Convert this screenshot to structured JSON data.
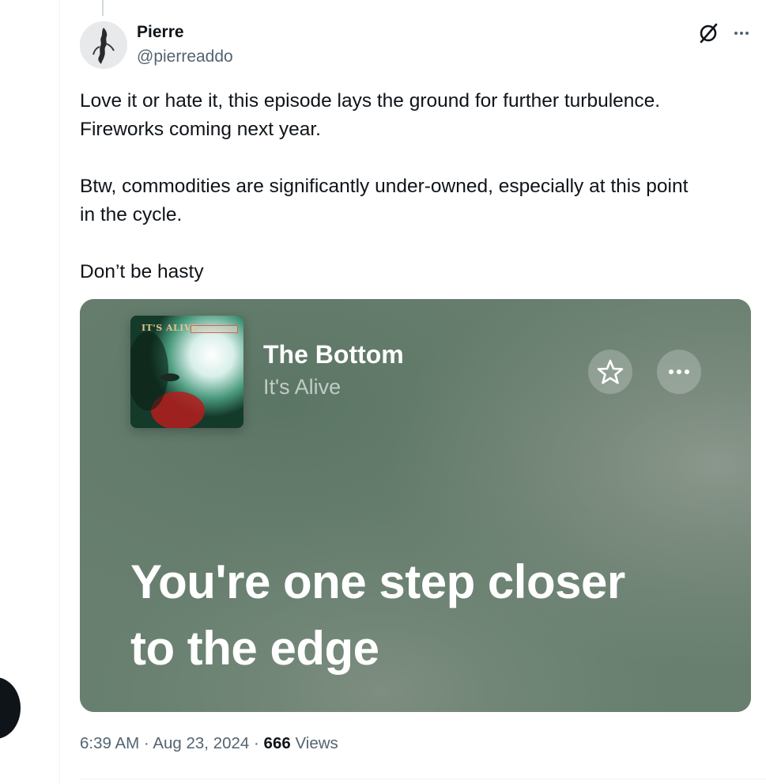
{
  "tweet": {
    "author": {
      "display_name": "Pierre",
      "handle": "@pierreaddo"
    },
    "icons": {
      "grok": "grok-icon",
      "more": "more-horizontal-icon"
    },
    "text_lines": [
      "Love it or hate it, this episode lays the ground for further turbulence.",
      "Fireworks coming next year.",
      "Btw, commodities are significantly under-owned, especially at this point",
      "in the cycle.",
      "Don’t be hasty"
    ],
    "media": {
      "album_label": "IT'S ALIVE",
      "song_title": "The Bottom",
      "artist": "It's Alive",
      "lyric_lines": [
        "You're one step closer",
        "to the edge"
      ],
      "background_color": "#6d8474"
    },
    "meta": {
      "time": "6:39 AM",
      "separator": "·",
      "date": "Aug 23, 2024",
      "views_count": "666",
      "views_label": "Views"
    }
  }
}
